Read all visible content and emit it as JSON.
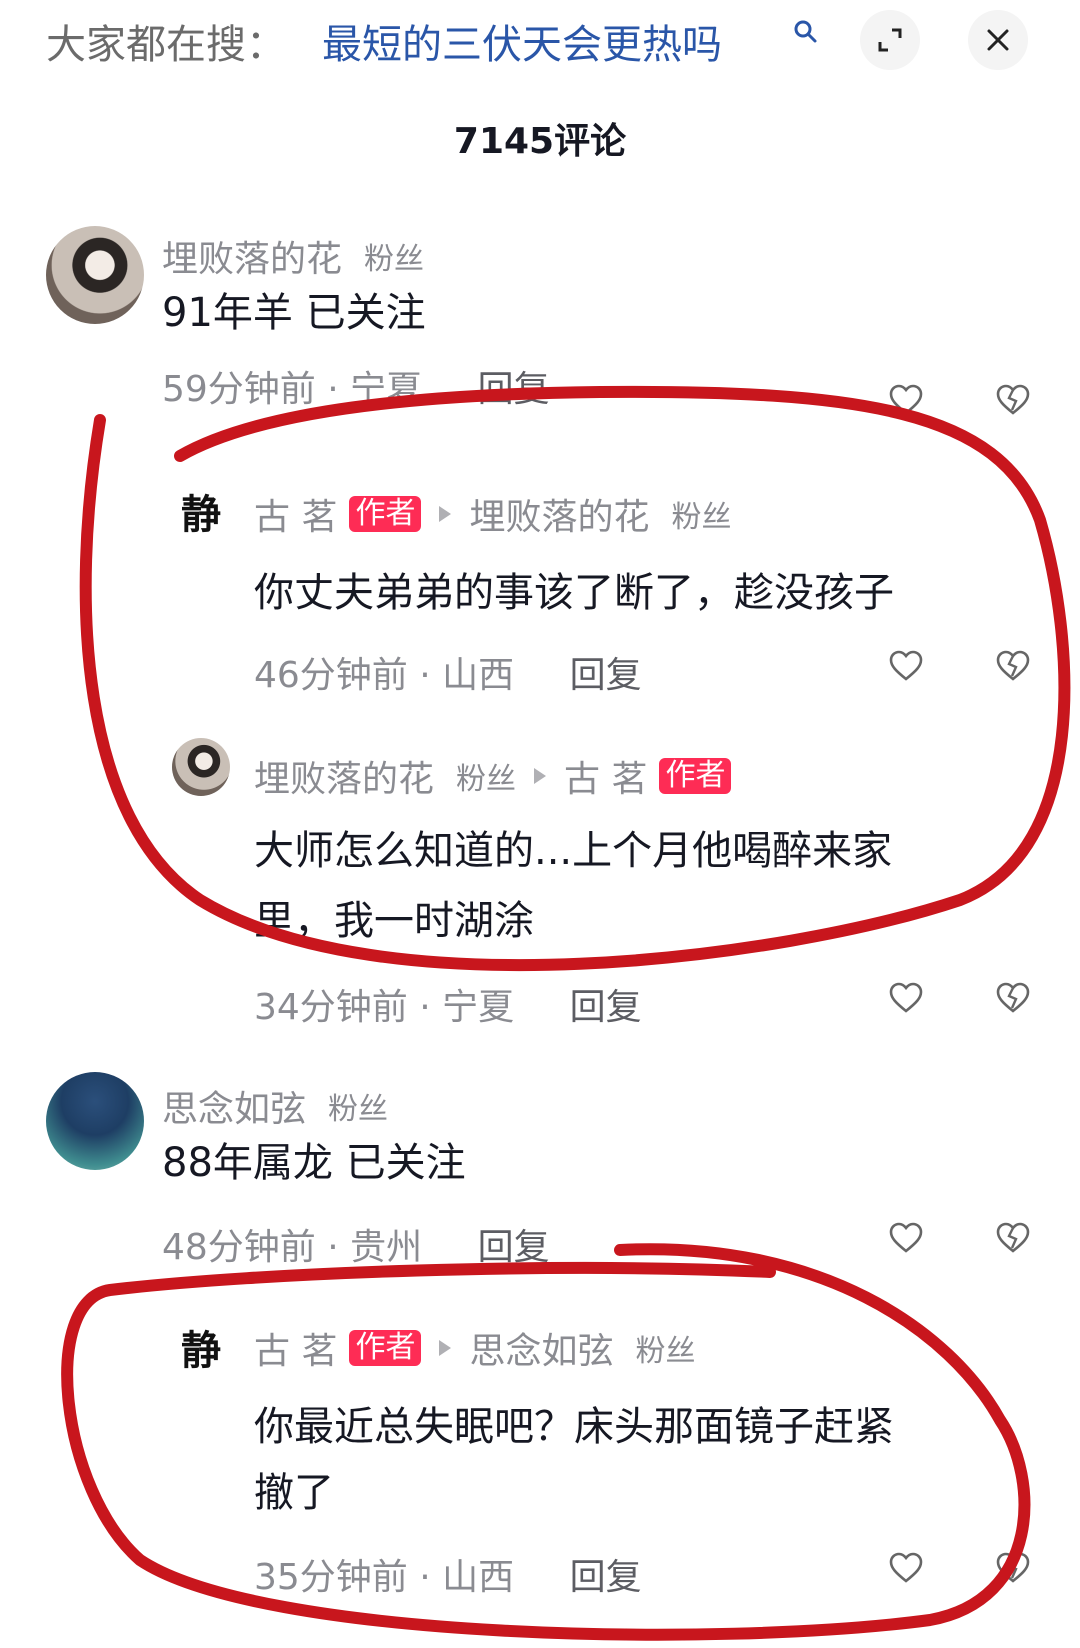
{
  "search_bar": {
    "prefix": "大家都在搜：",
    "query": "最短的三伏天会更热吗"
  },
  "comment_count": "7145评论",
  "comments": [
    {
      "user": "埋败落的花",
      "tag": "粉丝",
      "text": "91年羊 已关注",
      "time_location": "59分钟前 · 宁夏",
      "reply": "回复",
      "replies": [
        {
          "user": "古 茗",
          "badge": "作者",
          "reply_to": "埋败落的花",
          "reply_to_tag": "粉丝",
          "text": "你丈夫弟弟的事该了断了，趁没孩子",
          "time_location": "46分钟前 · 山西",
          "reply": "回复"
        },
        {
          "user": "埋败落的花",
          "tag": "粉丝",
          "reply_to": "古 茗",
          "reply_to_badge": "作者",
          "text_line1": "大师怎么知道的...上个月他喝醉来家",
          "text_line2": "里，我一时湖涂",
          "time_location": "34分钟前 · 宁夏",
          "reply": "回复"
        }
      ]
    },
    {
      "user": "思念如弦",
      "tag": "粉丝",
      "text": "88年属龙 已关注",
      "time_location": "48分钟前 · 贵州",
      "reply": "回复",
      "replies": [
        {
          "user": "古 茗",
          "badge": "作者",
          "reply_to": "思念如弦",
          "reply_to_tag": "粉丝",
          "text_line1": "你最近总失眠吧？床头那面镜子赶紧",
          "text_line2": "撤了",
          "time_location": "35分钟前 · 山西",
          "reply": "回复"
        }
      ]
    }
  ],
  "author_avatar_glyph": "静",
  "colors": {
    "query_blue": "#2a56a8",
    "author_badge": "#fe2c55",
    "annotation_red": "#c8161d",
    "muted_gray": "#8a8b91"
  }
}
